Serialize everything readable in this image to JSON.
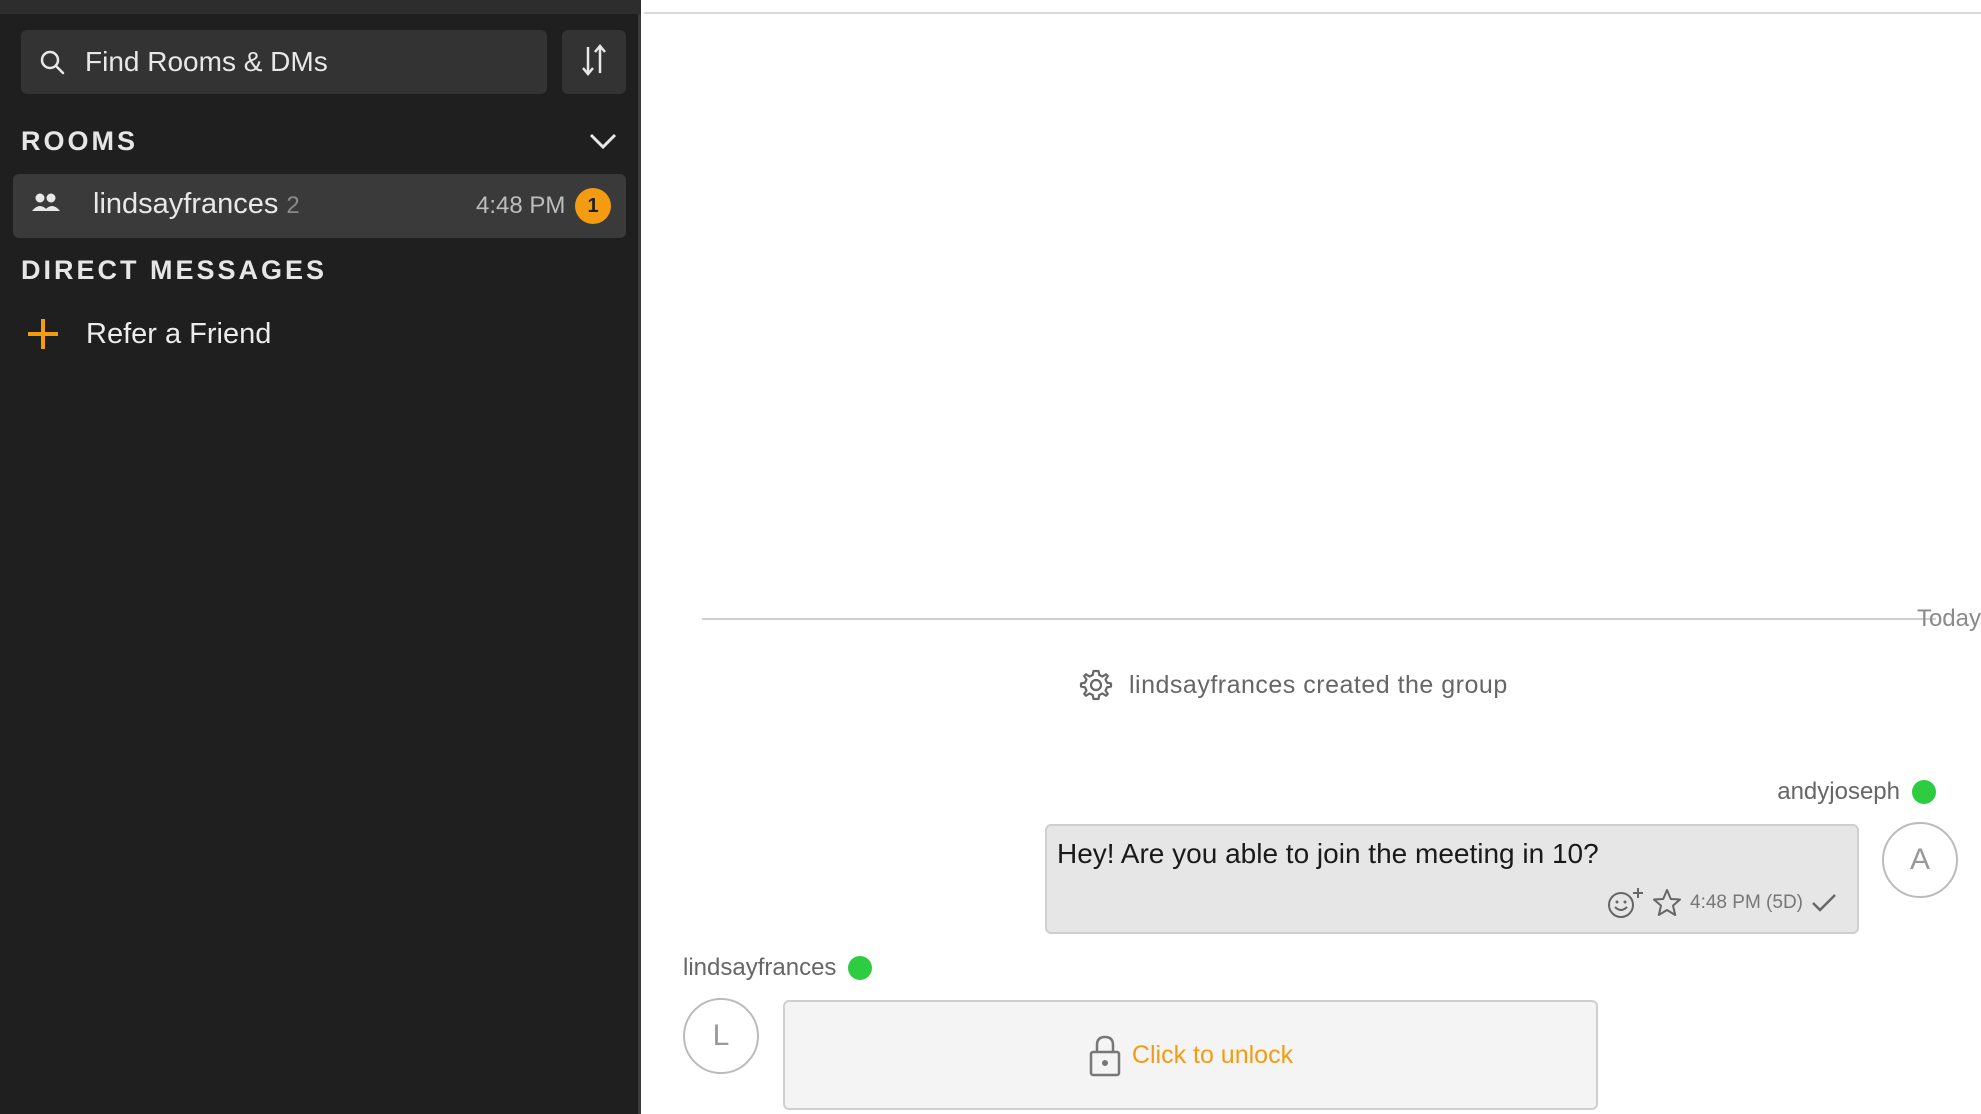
{
  "sidebar": {
    "search": {
      "placeholder": "Find Rooms & DMs",
      "icon": "search-icon"
    },
    "sort_icon": "sort-icon",
    "rooms_header": "ROOMS",
    "rooms": [
      {
        "name": "lindsayfrances",
        "member_count": "2",
        "time": "4:48 PM",
        "unread": "1",
        "icon": "group-icon"
      }
    ],
    "dm_header": "DIRECT MESSAGES",
    "refer": {
      "label": "Refer a Friend",
      "icon": "plus-icon"
    }
  },
  "chat": {
    "date_divider": "Today",
    "system_message": "lindsayfrances created the group",
    "messages": [
      {
        "sender": "andyjoseph",
        "avatar_initial": "A",
        "text": "Hey! Are you able to join the meeting in 10?",
        "time": "4:48 PM (5D)",
        "online": true
      },
      {
        "sender": "lindsayfrances",
        "avatar_initial": "L",
        "locked_label": "Click to unlock",
        "online": true
      }
    ]
  },
  "colors": {
    "sidebar_bg": "#1f1f1f",
    "accent": "#f39c12",
    "online": "#2ecc40"
  }
}
